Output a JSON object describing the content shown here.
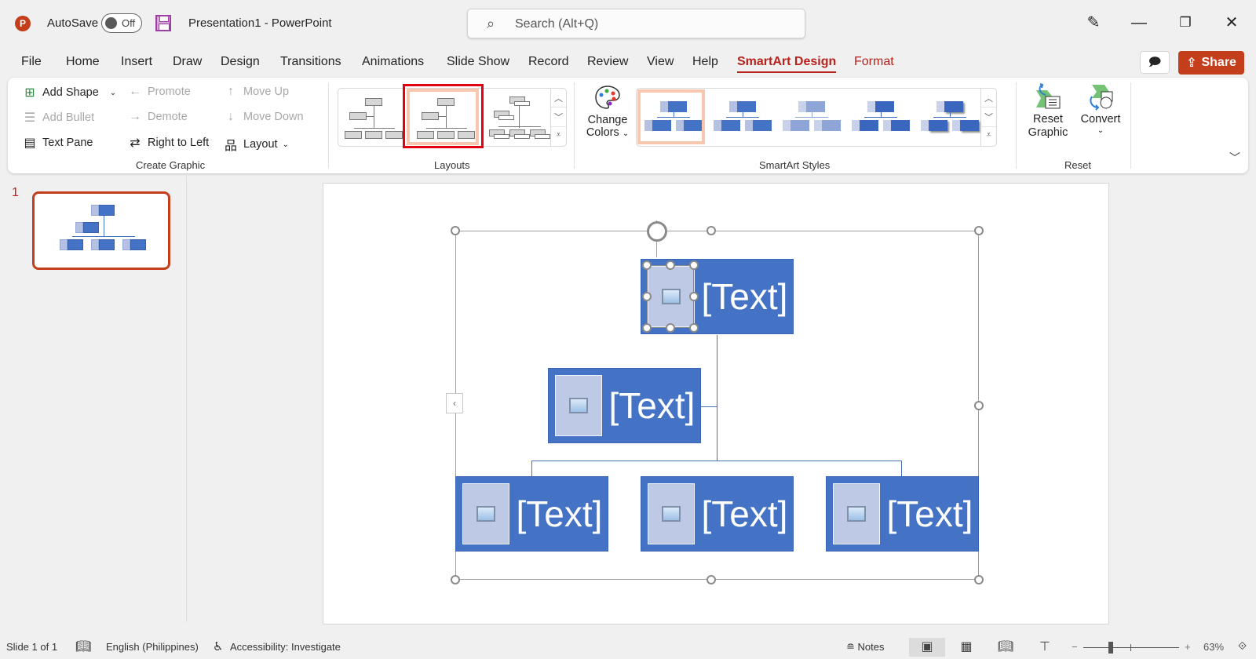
{
  "app": {
    "logo": "P",
    "autosave_label": "AutoSave",
    "autosave_state": "Off",
    "document_title": "Presentation1  -  PowerPoint",
    "search_placeholder": "Search (Alt+Q)",
    "window_controls": {
      "minimize": "—",
      "restore": "❐",
      "close": "✕"
    }
  },
  "tabs": [
    {
      "label": "File"
    },
    {
      "label": "Home"
    },
    {
      "label": "Insert"
    },
    {
      "label": "Draw"
    },
    {
      "label": "Design"
    },
    {
      "label": "Transitions"
    },
    {
      "label": "Animations"
    },
    {
      "label": "Slide Show"
    },
    {
      "label": "Record"
    },
    {
      "label": "Review"
    },
    {
      "label": "View"
    },
    {
      "label": "Help"
    },
    {
      "label": "SmartArt Design",
      "active": true
    },
    {
      "label": "Format",
      "contextual": true
    }
  ],
  "header_actions": {
    "share_label": "Share",
    "comment_icon": "comment-icon"
  },
  "ribbon": {
    "create_graphic": {
      "label": "Create Graphic",
      "add_shape": "Add Shape",
      "add_bullet": "Add Bullet",
      "text_pane": "Text Pane",
      "promote": "Promote",
      "demote": "Demote",
      "right_to_left": "Right to Left",
      "move_up": "Move Up",
      "move_down": "Move Down",
      "layout": "Layout"
    },
    "layouts": {
      "label": "Layouts",
      "selected_index": 1,
      "items": [
        "Organization Chart",
        "Picture Organization Chart",
        "Name and Title Organization Chart"
      ]
    },
    "change_colors": {
      "line1": "Change",
      "line2": "Colors"
    },
    "smartart_styles": {
      "label": "SmartArt Styles",
      "selected_index": 0,
      "count": 5
    },
    "reset": {
      "label": "Reset",
      "reset_graphic_1": "Reset",
      "reset_graphic_2": "Graphic",
      "convert": "Convert"
    }
  },
  "slides": {
    "current_number": "1"
  },
  "smartart": {
    "nodes": [
      {
        "level": 0,
        "text": "[Text]"
      },
      {
        "level": "assistant",
        "text": "[Text]"
      },
      {
        "level": 1,
        "text": "[Text]"
      },
      {
        "level": 1,
        "text": "[Text]"
      },
      {
        "level": 1,
        "text": "[Text]"
      }
    ],
    "colors": {
      "node_fill": "#4472C4",
      "picture_fill": "#BEC9E6",
      "accent": "#C43E1C"
    }
  },
  "status": {
    "slide_info": "Slide 1 of 1",
    "language": "English (Philippines)",
    "accessibility": "Accessibility: Investigate",
    "notes": "Notes",
    "zoom_level": "63%",
    "zoom_fraction": 0.63
  }
}
